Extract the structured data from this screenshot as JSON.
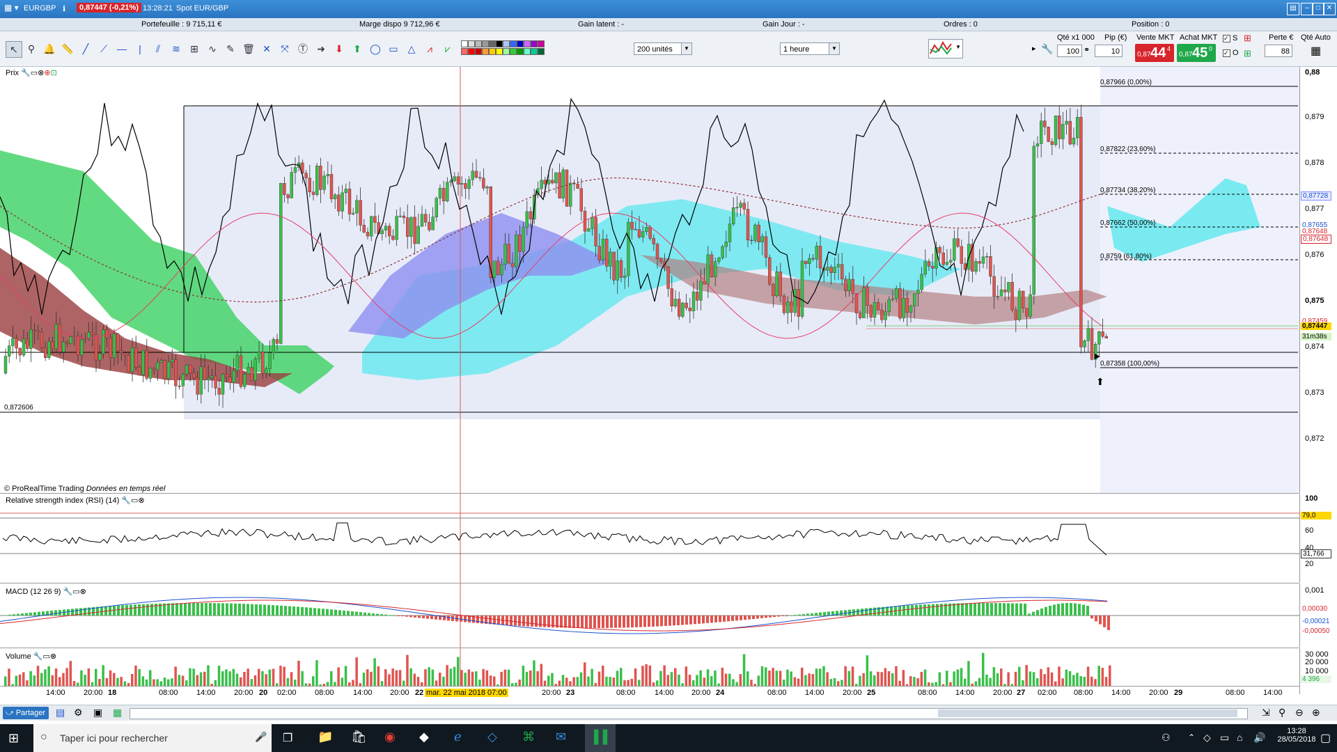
{
  "window": {
    "title": "EURGBP",
    "price_badge": "0,87447 (-0,21%)",
    "time": "13:28:21",
    "instrument": "Spot EUR/GBP"
  },
  "infobar": {
    "portefeuille": "Portefeuille : 9 715,11 €",
    "marge": "Marge dispo 9 712,96 €",
    "gain_latent": "Gain latent : -",
    "gain_jour": "Gain Jour : -",
    "ordres": "Ordres : 0",
    "position": "Position : 0"
  },
  "toolbar": {
    "units_select": "200 unités",
    "period_select": "1 heure"
  },
  "order_panel": {
    "qty_label": "Qté x1 000",
    "qty_value": "100",
    "pip_label": "Pip (€)",
    "pip_value": "10",
    "sell_label": "Vente MKT",
    "sell_small": "0,87",
    "sell_big": "44",
    "sell_sup": "4",
    "buy_label": "Achat MKT",
    "buy_small": "0,87",
    "buy_big": "45",
    "buy_sup": "0",
    "s_label": "S",
    "o_label": "O",
    "loss_label": "Perte €",
    "loss_value": "88",
    "auto_label": "Qté Auto"
  },
  "price_panel": {
    "label": "Prix",
    "copyright": "© ProRealTime Trading",
    "realtime": "Données en temps réel",
    "left_level": "0,872606",
    "axis_ticks": [
      "0,88",
      "0,879",
      "0,878",
      "0,877",
      "0,876",
      "0,875",
      "0,874",
      "0,873",
      "0,872"
    ],
    "fib_levels": [
      {
        "label": "0,87966 (0,00%)"
      },
      {
        "label": "0,87822 (23,60%)"
      },
      {
        "label": "0,87734 (38,20%)"
      },
      {
        "label": "0,87662 (50,00%)"
      },
      {
        "label": "0,8759 (61,80%)"
      },
      {
        "label": "0,87358 (100,00%)"
      }
    ],
    "tags": {
      "t1": "0,87728",
      "t2": "0,87655",
      "t3": "0,87648",
      "t4": "0,87648",
      "t5": "0,87459",
      "current": "0,87447",
      "countdown": "31m38s"
    }
  },
  "rsi_panel": {
    "label": "Relative strength index (RSI) (14)",
    "axis_ticks": [
      "100",
      "60",
      "40",
      "20"
    ],
    "overbought": "79,0",
    "value": "31,766"
  },
  "macd_panel": {
    "label": "MACD (12 26 9)",
    "axis_ticks": [
      "0,001"
    ],
    "tags": [
      "0,00030",
      "-0,00021",
      "-0,00050"
    ]
  },
  "volume_panel": {
    "label": "Volume",
    "axis_ticks": [
      "30 000",
      "20 000",
      "10 000"
    ],
    "value": "4 396"
  },
  "time_axis": {
    "labels": [
      "14:00",
      "20:00",
      "18",
      "08:00",
      "14:00",
      "20:00",
      "20",
      "02:00",
      "08:00",
      "14:00",
      "20:00",
      "22",
      "mar. 22 mai 2018 07:00",
      "20:00",
      "23",
      "08:00",
      "14:00",
      "20:00",
      "24",
      "08:00",
      "14:00",
      "20:00",
      "25",
      "08:00",
      "14:00",
      "20:00",
      "27",
      "02:00",
      "08:00",
      "14:00",
      "20:00",
      "29",
      "08:00",
      "14:00"
    ]
  },
  "bottom_bar": {
    "share_label": "Partager"
  },
  "taskbar": {
    "search_placeholder": "Taper ici pour rechercher",
    "clock_time": "13:28",
    "clock_date": "28/05/2018"
  }
}
